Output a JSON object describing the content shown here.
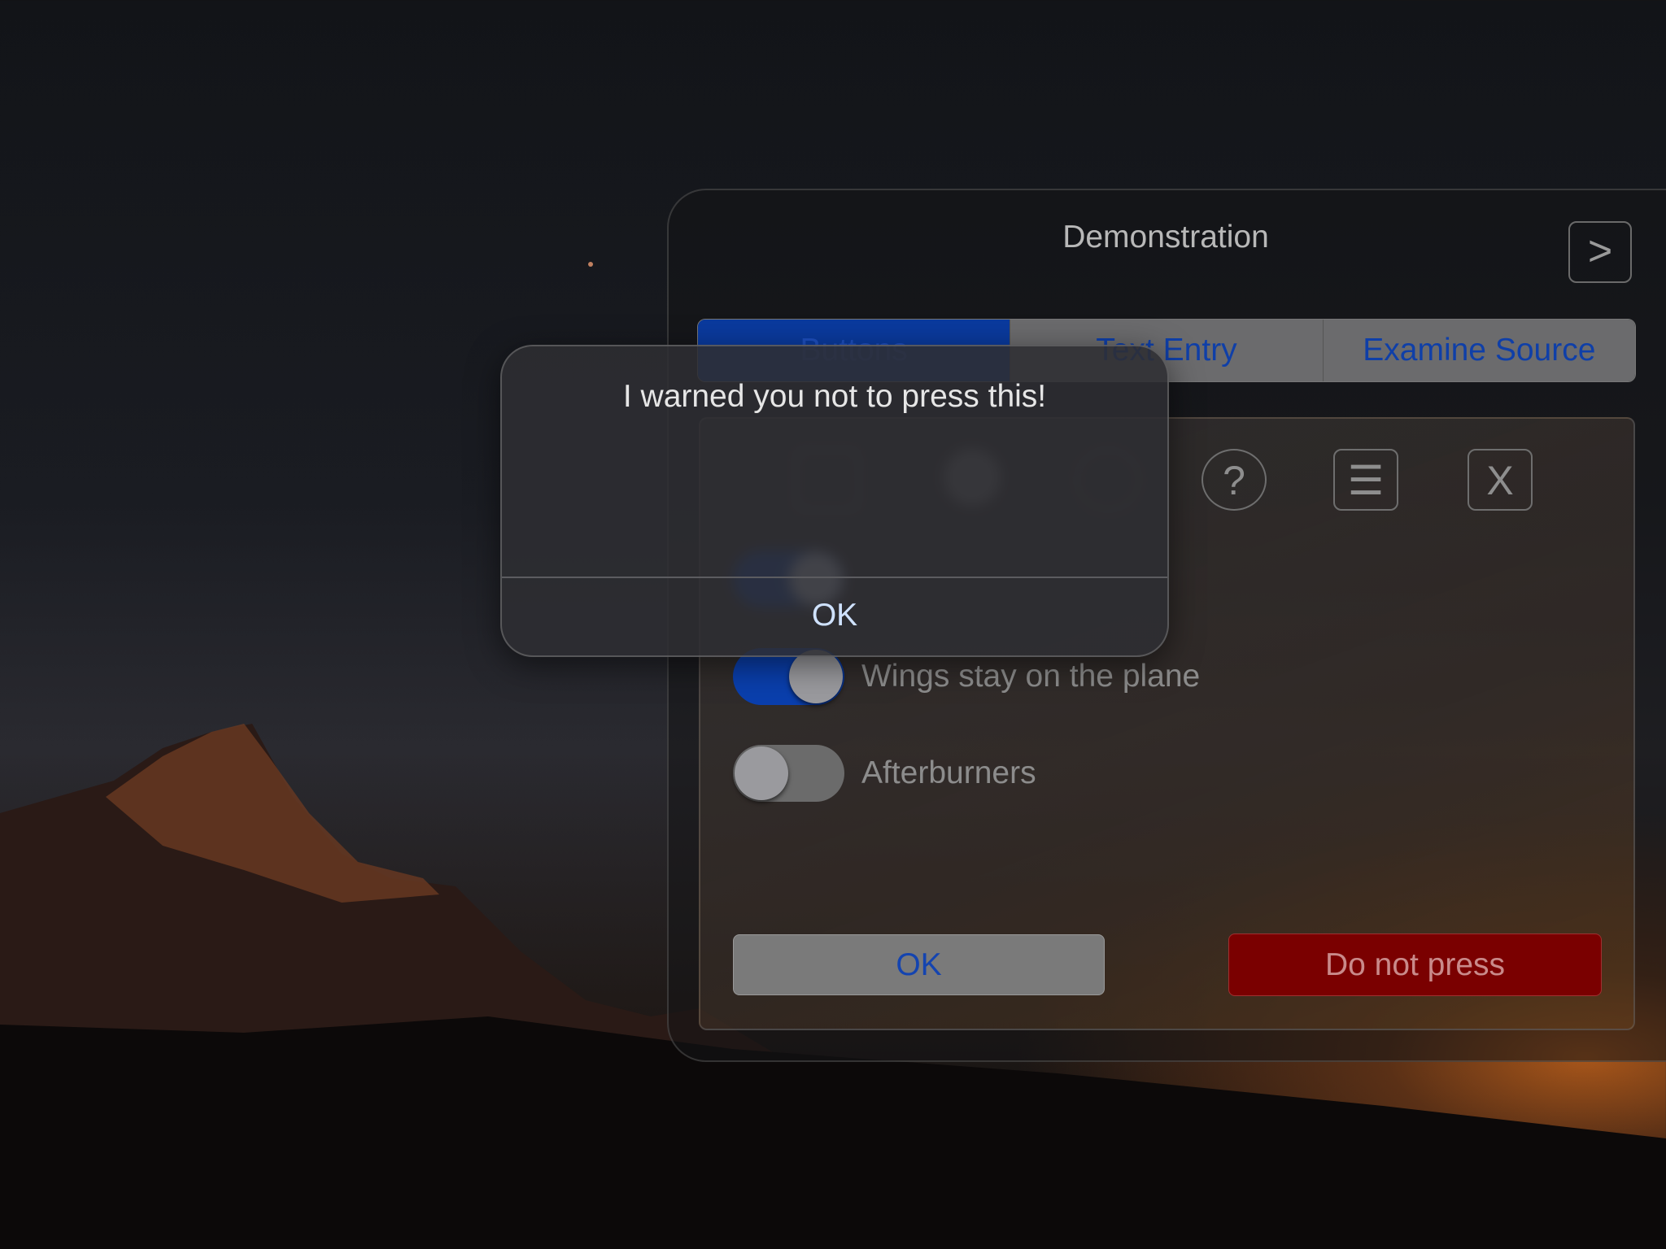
{
  "window": {
    "title": "Demonstration",
    "next_icon": "chevron-right-icon"
  },
  "tabs": [
    {
      "label": "Buttons",
      "active": true
    },
    {
      "label": "Text Entry",
      "active": false
    },
    {
      "label": "Examine Source",
      "active": false
    }
  ],
  "icon_buttons": [
    {
      "icon": "help-icon",
      "glyph": "?"
    },
    {
      "icon": "menu-icon",
      "glyph": "☰"
    },
    {
      "icon": "close-icon",
      "glyph": "X"
    }
  ],
  "toggles": [
    {
      "label": "Wings stay on the plane",
      "on": true
    },
    {
      "label": "Afterburners",
      "on": false
    }
  ],
  "buttons": {
    "ok": "OK",
    "do_not_press": "Do not press"
  },
  "alert": {
    "message": "I warned you not to press this!",
    "ok": "OK"
  },
  "colors": {
    "accent": "#0a3fad",
    "danger": "#7a0000"
  }
}
